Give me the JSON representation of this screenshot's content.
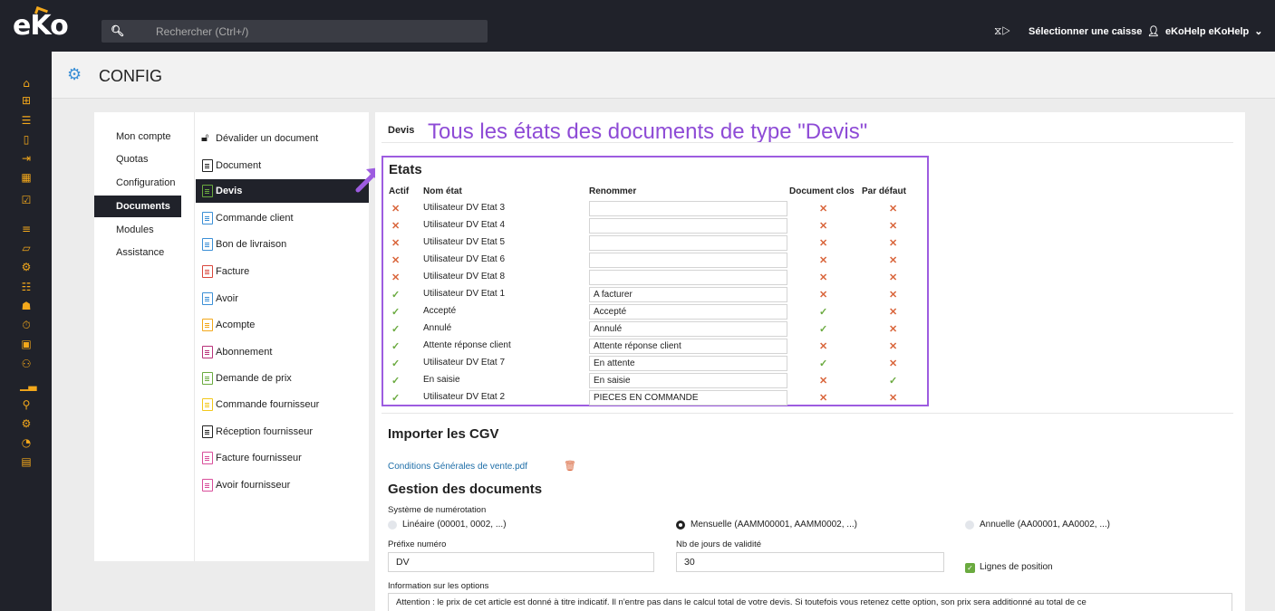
{
  "app": {
    "logo": "eKo"
  },
  "topbar": {
    "search_placeholder": "Rechercher (Ctrl+/)",
    "register_label": "Sélectionner une caisse",
    "user_label": "eKoHelp eKoHelp",
    "accent_color": "#f3a81b"
  },
  "page": {
    "title": "CONFIG"
  },
  "nav_primary": [
    {
      "label": "Mon compte"
    },
    {
      "label": "Quotas"
    },
    {
      "label": "Configuration"
    },
    {
      "label": "Documents",
      "active": true
    },
    {
      "label": "Modules"
    },
    {
      "label": "Assistance"
    }
  ],
  "nav_documents": [
    {
      "label": "Dévalider un document",
      "icon": "unlock-icon",
      "color": "#222222"
    },
    {
      "label": "Document",
      "icon": "document-icon",
      "color": "#222222"
    },
    {
      "label": "Devis",
      "icon": "devis-icon",
      "color": "#6aaa3f",
      "active": true
    },
    {
      "label": "Commande client",
      "icon": "order-icon",
      "color": "#3b8fd6"
    },
    {
      "label": "Bon de livraison",
      "icon": "delivery-icon",
      "color": "#3b8fd6"
    },
    {
      "label": "Facture",
      "icon": "invoice-icon",
      "color": "#d9453b"
    },
    {
      "label": "Avoir",
      "icon": "credit-icon",
      "color": "#3b8fd6"
    },
    {
      "label": "Acompte",
      "icon": "deposit-icon",
      "color": "#f3a81b"
    },
    {
      "label": "Abonnement",
      "icon": "subscription-icon",
      "color": "#b8327a"
    },
    {
      "label": "Demande de prix",
      "icon": "price-request-icon",
      "color": "#6aaa3f"
    },
    {
      "label": "Commande fournisseur",
      "icon": "supplier-order-icon",
      "color": "#f3c81b"
    },
    {
      "label": "Réception fournisseur",
      "icon": "supplier-receipt-icon",
      "color": "#222222"
    },
    {
      "label": "Facture fournisseur",
      "icon": "supplier-invoice-icon",
      "color": "#d94e9b"
    },
    {
      "label": "Avoir fournisseur",
      "icon": "supplier-credit-icon",
      "color": "#d94e9b"
    }
  ],
  "main": {
    "label": "Devis",
    "annotation": "Tous les états des documents de type \"Devis\"",
    "states": {
      "title": "Etats",
      "headers": {
        "actif": "Actif",
        "nom": "Nom état",
        "renommer": "Renommer",
        "clos": "Document clos",
        "defaut": "Par défaut"
      },
      "rows": [
        {
          "actif": "✕",
          "nom": "Utilisateur DV Etat 3",
          "rename": "",
          "clos": "✕",
          "defaut": "✕"
        },
        {
          "actif": "✕",
          "nom": "Utilisateur DV Etat 4",
          "rename": "",
          "clos": "✕",
          "defaut": "✕"
        },
        {
          "actif": "✕",
          "nom": "Utilisateur DV Etat 5",
          "rename": "",
          "clos": "✕",
          "defaut": "✕"
        },
        {
          "actif": "✕",
          "nom": "Utilisateur DV Etat 6",
          "rename": "",
          "clos": "✕",
          "defaut": "✕"
        },
        {
          "actif": "✕",
          "nom": "Utilisateur DV Etat 8",
          "rename": "",
          "clos": "✕",
          "defaut": "✕"
        },
        {
          "actif": "✓",
          "nom": "Utilisateur DV Etat 1",
          "rename": "A facturer",
          "clos": "✕",
          "defaut": "✕"
        },
        {
          "actif": "✓",
          "nom": "Accepté",
          "rename": "Accepté",
          "clos": "✓",
          "defaut": "✕"
        },
        {
          "actif": "✓",
          "nom": "Annulé",
          "rename": "Annulé",
          "clos": "✓",
          "defaut": "✕"
        },
        {
          "actif": "✓",
          "nom": "Attente réponse client",
          "rename": "Attente réponse client",
          "clos": "✕",
          "defaut": "✕"
        },
        {
          "actif": "✓",
          "nom": "Utilisateur DV Etat 7",
          "rename": "En attente",
          "clos": "✓",
          "defaut": "✕"
        },
        {
          "actif": "✓",
          "nom": "En saisie",
          "rename": "En saisie",
          "clos": "✕",
          "defaut": "✓"
        },
        {
          "actif": "✓",
          "nom": "Utilisateur DV Etat 2",
          "rename": "PIECES EN COMMANDE",
          "clos": "✕",
          "defaut": "✕"
        }
      ]
    },
    "cgv": {
      "title": "Importer les CGV",
      "file_link": "Conditions Générales de vente.pdf"
    },
    "gestion": {
      "title": "Gestion des documents",
      "numbering_label": "Système de numérotation",
      "options": [
        {
          "label": "Linéaire (00001, 0002, ...)",
          "checked": false
        },
        {
          "label": "Mensuelle (AAMM00001, AAMM0002, ...)",
          "checked": true
        },
        {
          "label": "Annuelle (AA00001, AA0002, ...)",
          "checked": false
        }
      ],
      "prefix_label": "Préfixe numéro",
      "prefix_value": "DV",
      "validity_label": "Nb de jours de validité",
      "validity_value": "30",
      "position_lines_label": "Lignes de position",
      "position_lines_checked": true,
      "info_label": "Information sur les options",
      "info_text": "Attention : le prix de cet article est donné à titre indicatif. Il n'entre pas dans le calcul total de votre devis. Si toutefois vous retenez cette option, son prix sera additionné au total de ce"
    }
  },
  "colors": {
    "ok": "#6aaa3f",
    "ko": "#d9653b",
    "annotation": "#8e4bd6",
    "dark": "#20222a"
  }
}
